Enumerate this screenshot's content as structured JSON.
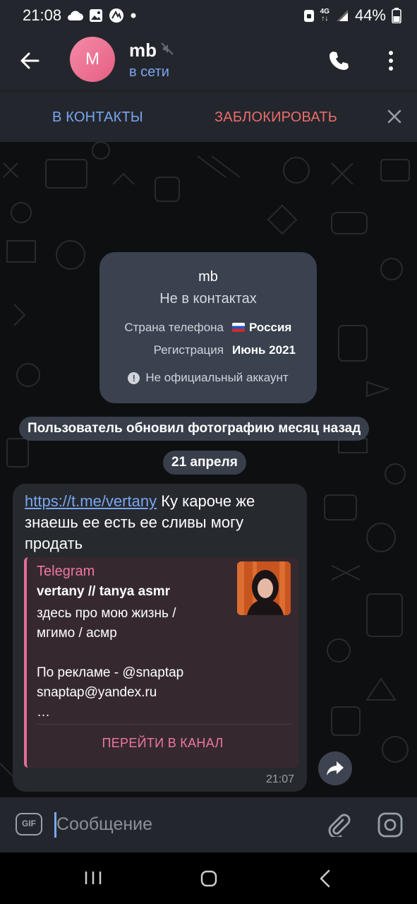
{
  "status_bar": {
    "time": "21:08",
    "network": "4G",
    "battery": "44%",
    "icons": [
      "cloud-icon",
      "gallery-icon",
      "app-icon",
      "dot-icon",
      "lock-icon",
      "signal-icon",
      "battery-icon"
    ]
  },
  "header": {
    "avatar_letter": "M",
    "name": "mb",
    "status": "в сети",
    "accent": "#7aa6f2",
    "icons": [
      "back-arrow-icon",
      "muted-icon",
      "phone-icon",
      "more-vert-icon"
    ]
  },
  "action_bar": {
    "add_contact": "В КОНТАКТЫ",
    "block": "ЗАБЛОКИРОВАТЬ",
    "block_color": "#ef6b6b"
  },
  "info_card": {
    "name": "mb",
    "subtitle": "Не в контактах",
    "phone_country_label": "Страна телефона",
    "phone_country_value": "Россия",
    "registration_label": "Регистрация",
    "registration_value": "Июнь 2021",
    "note": "Не официальный аккаунт"
  },
  "service_message": "Пользователь обновил фотографию месяц назад",
  "date_separator": "21 апреля",
  "message": {
    "link": "https://t.me/vertany",
    "text": " Ку кароче же знаешь ее есть ее сливы могу продать",
    "time": "21:07",
    "preview": {
      "site": "Telegram",
      "title": "vertany // tanya asmr",
      "description": "здесь про мою жизнь / мгимо / асмр\n\nПо рекламе - @snaptap\nsnaptap@yandex.ru\n…",
      "button": "ПЕРЕЙТИ В КАНАЛ",
      "accent": "#ee77a0"
    }
  },
  "input": {
    "placeholder": "Сообщение",
    "gif_label": "GIF"
  }
}
